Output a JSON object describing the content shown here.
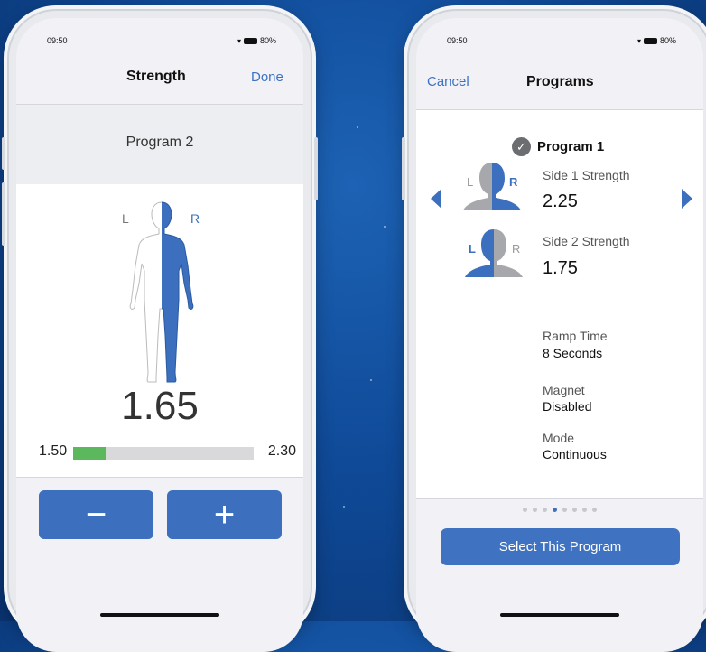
{
  "colors": {
    "accent": "#3c6fbd",
    "green": "#5cb85c",
    "gray_head": "#a6a8ab"
  },
  "left_phone": {
    "status": {
      "time": "09:50",
      "battery": "80%"
    },
    "nav": {
      "title": "Strength",
      "done": "Done"
    },
    "program_label": "Program 2",
    "body": {
      "left_label": "L",
      "right_label": "R"
    },
    "value": "1.65",
    "range": {
      "min_label": "1.50",
      "max_label": "2.30",
      "fill_fraction": 0.18
    },
    "decrease_symbol": "−",
    "increase_symbol": "+"
  },
  "right_phone": {
    "status": {
      "time": "09:50",
      "battery": "80%"
    },
    "nav": {
      "cancel": "Cancel",
      "title": "Programs"
    },
    "program": {
      "name": "Program 1",
      "side1": {
        "l": "L",
        "r": "R",
        "label": "Side 1 Strength",
        "value": "2.25"
      },
      "side2": {
        "l": "L",
        "r": "R",
        "label": "Side 2 Strength",
        "value": "1.75"
      },
      "ramp": {
        "label": "Ramp Time",
        "value": "8 Seconds"
      },
      "magnet": {
        "label": "Magnet",
        "value": "Disabled"
      },
      "mode": {
        "label": "Mode",
        "value": "Continuous"
      }
    },
    "pager": {
      "count": 8,
      "active_index": 3
    },
    "select_button": "Select This Program"
  }
}
